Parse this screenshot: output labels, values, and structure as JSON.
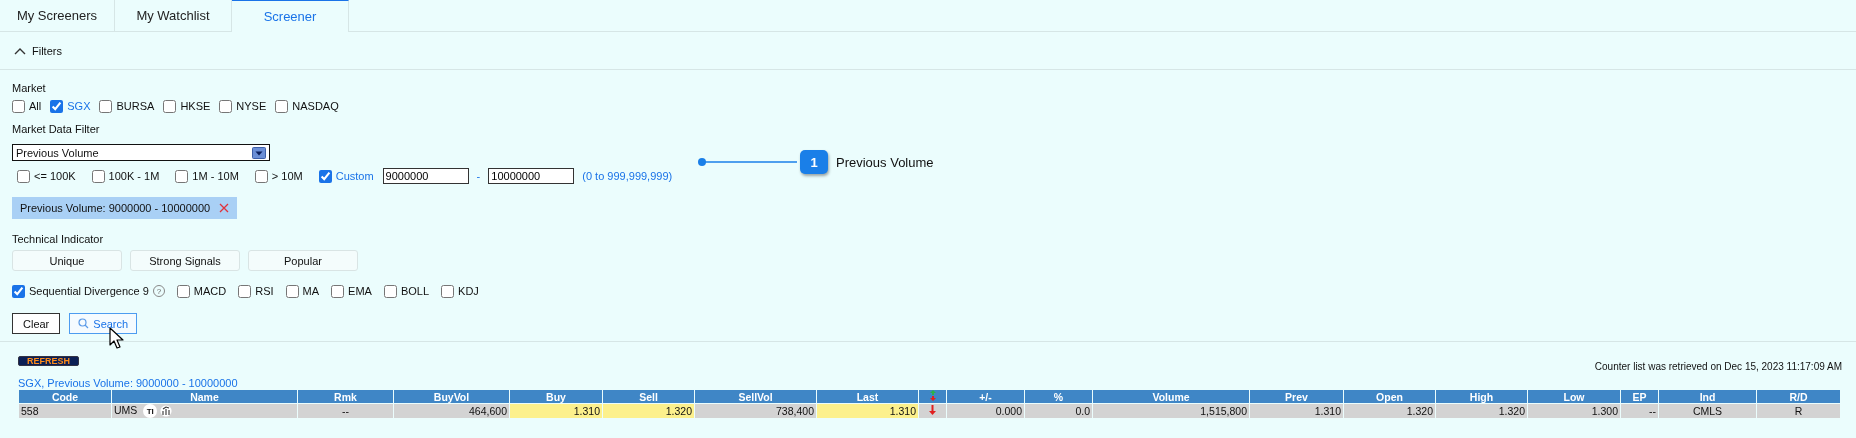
{
  "tabs": [
    {
      "label": "My Screeners",
      "selected": false
    },
    {
      "label": "My Watchlist",
      "selected": false
    },
    {
      "label": "Screener",
      "selected": true
    }
  ],
  "filters": {
    "title": "Filters",
    "expanded": true
  },
  "market": {
    "label": "Market",
    "options": [
      {
        "label": "All",
        "checked": false
      },
      {
        "label": "SGX",
        "checked": true
      },
      {
        "label": "BURSA",
        "checked": false
      },
      {
        "label": "HKSE",
        "checked": false
      },
      {
        "label": "NYSE",
        "checked": false
      },
      {
        "label": "NASDAQ",
        "checked": false
      }
    ]
  },
  "market_data_filter": {
    "label": "Market Data Filter",
    "dropdown": {
      "value": "Previous Volume"
    },
    "ranges": [
      {
        "label": "<= 100K",
        "checked": false
      },
      {
        "label": "100K - 1M",
        "checked": false
      },
      {
        "label": "1M - 10M",
        "checked": false
      },
      {
        "label": "> 10M",
        "checked": false
      }
    ],
    "custom": {
      "label": "Custom",
      "checked": true,
      "from": "9000000",
      "separator": "-",
      "to": "10000000",
      "hint": "(0 to 999,999,999)"
    }
  },
  "active_filter": {
    "text": "Previous Volume: 9000000 - 10000000"
  },
  "technical_indicator": {
    "label": "Technical Indicator",
    "presets": [
      "Unique",
      "Strong Signals",
      "Popular"
    ],
    "indicators": [
      {
        "label": "Sequential Divergence 9",
        "checked": true,
        "help": "?"
      },
      {
        "label": "MACD",
        "checked": false
      },
      {
        "label": "RSI",
        "checked": false
      },
      {
        "label": "MA",
        "checked": false
      },
      {
        "label": "EMA",
        "checked": false
      },
      {
        "label": "BOLL",
        "checked": false
      },
      {
        "label": "KDJ",
        "checked": false
      }
    ]
  },
  "actions": [
    {
      "label": "Clear",
      "kind": "plain"
    },
    {
      "label": "Search",
      "kind": "search"
    }
  ],
  "annotation": {
    "number": "1",
    "text": "Previous Volume"
  },
  "results": {
    "refresh": "REFRESH",
    "retrieved": "Counter list was retrieved on Dec 15, 2023 11:17:09 AM",
    "caption": "SGX, Previous Volume: 9000000 - 10000000",
    "columns": [
      {
        "kind": "text",
        "label": "Code"
      },
      {
        "kind": "text",
        "label": "Name"
      },
      {
        "kind": "text",
        "label": "Rmk"
      },
      {
        "kind": "text",
        "label": "BuyVol"
      },
      {
        "kind": "text",
        "label": "Buy"
      },
      {
        "kind": "text",
        "label": "Sell"
      },
      {
        "kind": "text",
        "label": "SellVol"
      },
      {
        "kind": "text",
        "label": "Last"
      },
      {
        "kind": "trend"
      },
      {
        "kind": "text",
        "label": "+/-"
      },
      {
        "kind": "text",
        "label": "%"
      },
      {
        "kind": "text",
        "label": "Volume"
      },
      {
        "kind": "text",
        "label": "Prev"
      },
      {
        "kind": "text",
        "label": "Open"
      },
      {
        "kind": "text",
        "label": "High"
      },
      {
        "kind": "text",
        "label": "Low"
      },
      {
        "kind": "text",
        "label": "EP"
      },
      {
        "kind": "text",
        "label": "Ind"
      },
      {
        "kind": "text",
        "label": "R/D"
      }
    ],
    "rows": [
      {
        "cells": [
          {
            "kind": "text",
            "text": "558",
            "highlight": false
          },
          {
            "kind": "name",
            "text": "UMS",
            "badge": "TI",
            "highlight": false
          },
          {
            "kind": "text",
            "text": "--",
            "highlight": false
          },
          {
            "kind": "text",
            "text": "464,600",
            "highlight": false
          },
          {
            "kind": "text",
            "text": "1.310",
            "highlight": true
          },
          {
            "kind": "text",
            "text": "1.320",
            "highlight": true
          },
          {
            "kind": "text",
            "text": "738,400",
            "highlight": false
          },
          {
            "kind": "text",
            "text": "1.310",
            "highlight": true
          },
          {
            "kind": "trend",
            "falling": true,
            "highlight": false
          },
          {
            "kind": "text",
            "text": "0.000",
            "highlight": false
          },
          {
            "kind": "text",
            "text": "0.0",
            "highlight": false
          },
          {
            "kind": "text",
            "text": "1,515,800",
            "highlight": false
          },
          {
            "kind": "text",
            "text": "1.310",
            "highlight": false
          },
          {
            "kind": "text",
            "text": "1.320",
            "highlight": false
          },
          {
            "kind": "text",
            "text": "1.320",
            "highlight": false
          },
          {
            "kind": "text",
            "text": "1.300",
            "highlight": false
          },
          {
            "kind": "text",
            "text": "--",
            "highlight": false
          },
          {
            "kind": "text",
            "text": "CMLS",
            "highlight": false
          },
          {
            "kind": "text",
            "text": "R",
            "highlight": false
          }
        ]
      }
    ]
  }
}
